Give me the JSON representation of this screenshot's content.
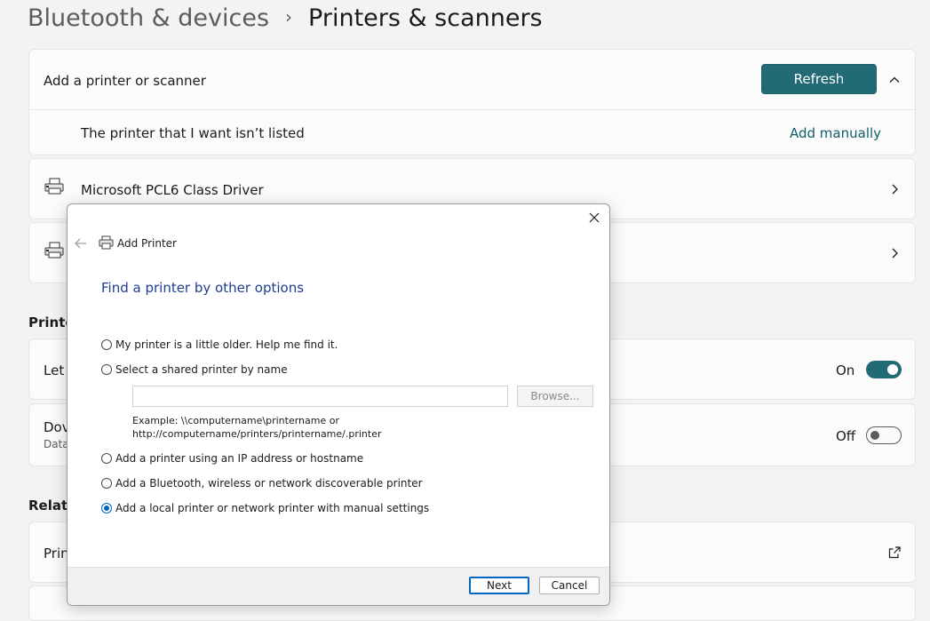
{
  "breadcrumb": {
    "parent": "Bluetooth & devices",
    "separator": "›",
    "current": "Printers & scanners"
  },
  "add_printer": {
    "title": "Add a printer or scanner",
    "refresh_label": "Refresh",
    "not_listed_text": "The printer that I want isn’t listed",
    "add_manually_label": "Add manually"
  },
  "printers": [
    {
      "name": "Microsoft PCL6 Class Driver"
    },
    {
      "name": ""
    }
  ],
  "sections": {
    "preferences_label_partial": "Printe",
    "related_label_partial": "Relate"
  },
  "settings": {
    "let_partial": "Let",
    "let_state": "On",
    "download_partial": "Dov",
    "download_sub_partial": "Data",
    "download_state": "Off",
    "related_item_partial": "Prin"
  },
  "dialog": {
    "title": "Add Printer",
    "heading": "Find a printer by other options",
    "options": [
      {
        "label": "My printer is a little older. Help me find it.",
        "selected": false
      },
      {
        "label": "Select a shared printer by name",
        "selected": false
      },
      {
        "label": "Add a printer using an IP address or hostname",
        "selected": false
      },
      {
        "label": "Add a Bluetooth, wireless or network discoverable printer",
        "selected": false
      },
      {
        "label": "Add a local printer or network printer with manual settings",
        "selected": true
      }
    ],
    "shared_input_value": "",
    "browse_label": "Browse...",
    "example_line1": "Example: \\\\computername\\printername or",
    "example_line2": "http://computername/printers/printername/.printer",
    "next_label": "Next",
    "cancel_label": "Cancel"
  },
  "colors": {
    "accent": "#226a74",
    "dialog_link": "#1e3d8f",
    "radio_selected": "#0067c0"
  }
}
